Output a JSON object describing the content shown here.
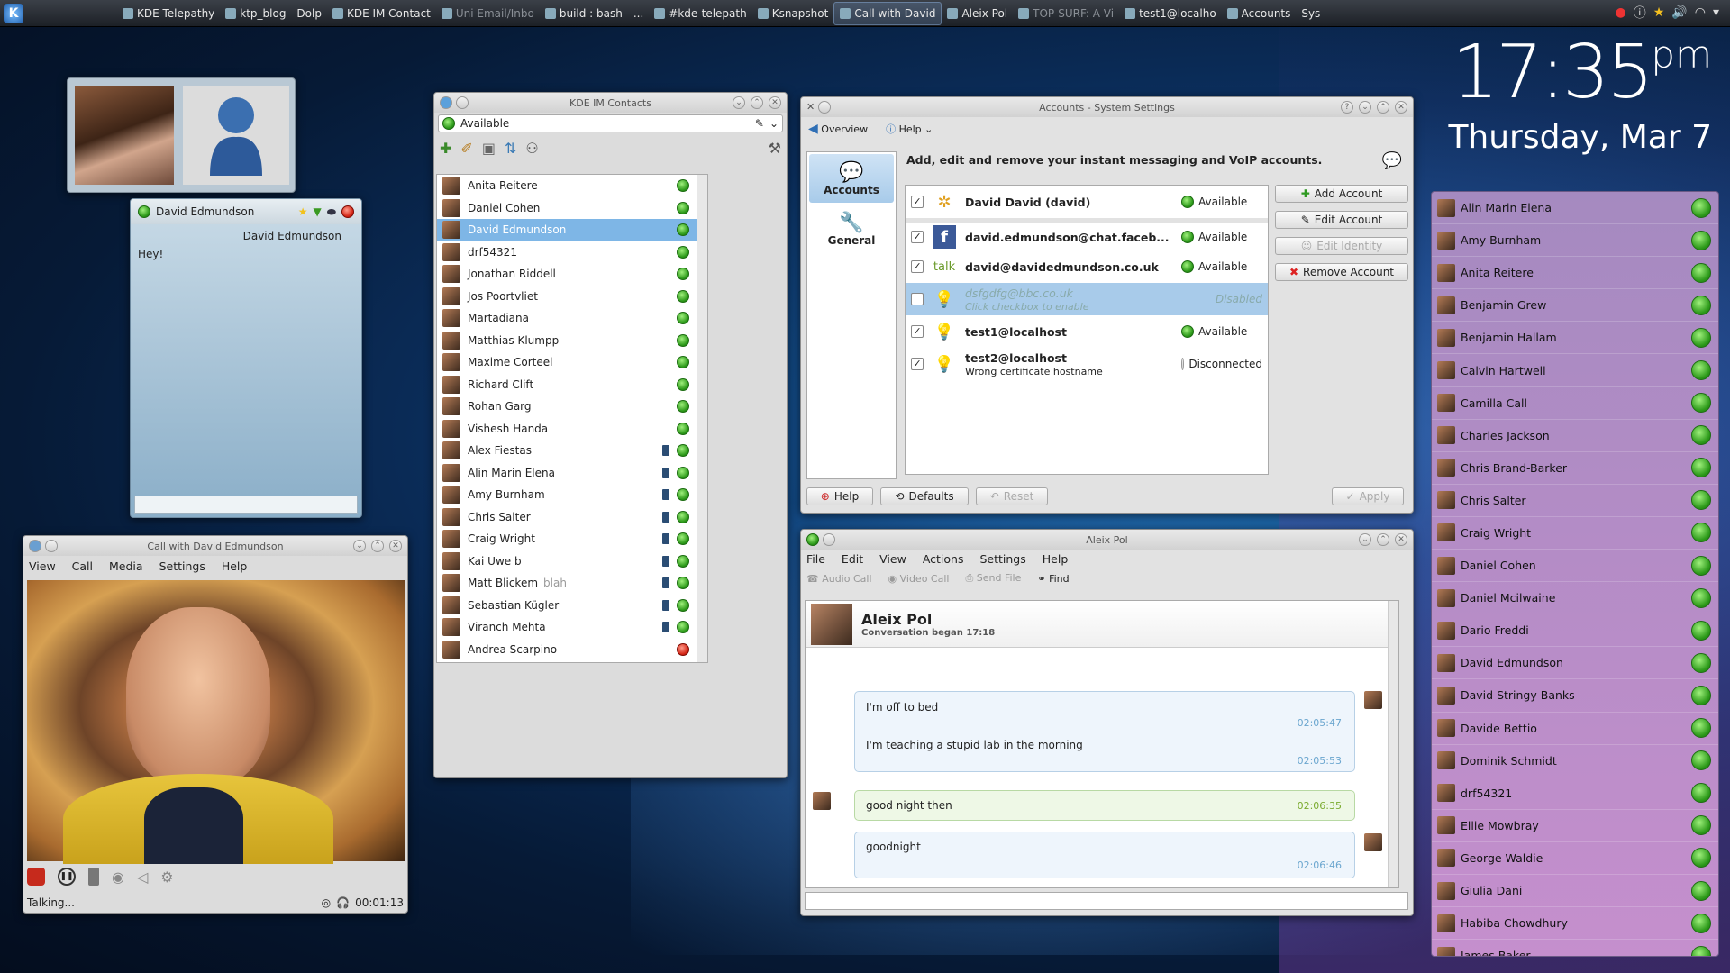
{
  "taskbar": {
    "tasks": [
      "KDE Telepathy",
      "ktp_blog - Dolp",
      "KDE IM Contact",
      "Uni Email/Inbo",
      "build : bash - ...",
      "#kde-telepath",
      "Ksnapshot",
      "Call with David",
      "Aleix Pol",
      "TOP-SURF: A Vi",
      "test1@localho",
      "Accounts - Sys"
    ]
  },
  "clock": {
    "time": "17:35",
    "ampm": "pm",
    "date": "Thursday, Mar 7"
  },
  "contact_popup": {
    "name": "David Edmundson",
    "header": "David Edmundson",
    "message": "Hey!"
  },
  "contacts_window": {
    "title": "KDE IM Contacts",
    "status": "Available",
    "contacts": [
      {
        "name": "Anita Reitere",
        "phone": false,
        "status": "available"
      },
      {
        "name": "Daniel Cohen",
        "phone": false,
        "status": "available"
      },
      {
        "name": "David Edmundson",
        "phone": false,
        "status": "available",
        "selected": true
      },
      {
        "name": "drf54321",
        "phone": false,
        "status": "available"
      },
      {
        "name": "Jonathan Riddell",
        "phone": false,
        "status": "available"
      },
      {
        "name": "Jos Poortvliet",
        "phone": false,
        "status": "available"
      },
      {
        "name": "Martadiana",
        "phone": false,
        "status": "available"
      },
      {
        "name": "Matthias Klumpp",
        "phone": false,
        "status": "available"
      },
      {
        "name": "Maxime Corteel",
        "phone": false,
        "status": "available"
      },
      {
        "name": "Richard Clift",
        "phone": false,
        "status": "available"
      },
      {
        "name": "Rohan Garg",
        "phone": false,
        "status": "available"
      },
      {
        "name": "Vishesh Handa",
        "phone": false,
        "status": "available"
      },
      {
        "name": "Alex Fiestas",
        "phone": true,
        "status": "available"
      },
      {
        "name": "Alin Marin Elena",
        "phone": true,
        "status": "available"
      },
      {
        "name": "Amy Burnham",
        "phone": true,
        "status": "available"
      },
      {
        "name": "Chris Salter",
        "phone": true,
        "status": "available"
      },
      {
        "name": "Craig Wright",
        "phone": true,
        "status": "available"
      },
      {
        "name": "Kai Uwe b",
        "phone": true,
        "status": "available"
      },
      {
        "name": "Matt Blickem",
        "note": "blah",
        "phone": true,
        "status": "available"
      },
      {
        "name": "Sebastian Kügler",
        "phone": true,
        "status": "available"
      },
      {
        "name": "Viranch Mehta",
        "phone": true,
        "status": "available"
      },
      {
        "name": "Andrea Scarpino",
        "phone": false,
        "status": "busy"
      }
    ]
  },
  "call_window": {
    "title": "Call with David Edmundson",
    "menu": [
      "View",
      "Call",
      "Media",
      "Settings",
      "Help"
    ],
    "status": "Talking...",
    "duration": "00:01:13"
  },
  "settings_window": {
    "title": "Accounts - System Settings",
    "toolbar": {
      "overview": "Overview",
      "help": "Help"
    },
    "sidebar": [
      "Accounts",
      "General"
    ],
    "heading": "Add, edit and remove your instant messaging and VoIP accounts.",
    "accounts": [
      {
        "name": "David David (david)",
        "sub": "",
        "status": "Available",
        "checked": true,
        "enabled": true
      },
      {
        "name": "david.edmundson@chat.faceb...",
        "sub": "",
        "status": "Available",
        "checked": true,
        "enabled": true
      },
      {
        "name": "david@davidedmundson.co.uk",
        "sub": "",
        "status": "Available",
        "checked": true,
        "enabled": true
      },
      {
        "name": "dsfgdfg@bbc.co.uk",
        "sub": "Click checkbox to enable",
        "status": "Disabled",
        "checked": false,
        "enabled": false
      },
      {
        "name": "test1@localhost",
        "sub": "",
        "status": "Available",
        "checked": true,
        "enabled": true
      },
      {
        "name": "test2@localhost",
        "sub": "Wrong certificate hostname",
        "status": "Disconnected",
        "checked": true,
        "enabled": true
      }
    ],
    "buttons": {
      "add": "Add Account",
      "edit": "Edit Account",
      "identity": "Edit Identity",
      "remove": "Remove Account"
    },
    "bottom": {
      "help": "Help",
      "defaults": "Defaults",
      "reset": "Reset",
      "apply": "Apply"
    }
  },
  "chat_window": {
    "title": "Aleix Pol",
    "menu": [
      "File",
      "Edit",
      "View",
      "Actions",
      "Settings",
      "Help"
    ],
    "toolbar": {
      "audio": "Audio Call",
      "video": "Video Call",
      "file": "Send File",
      "find": "Find"
    },
    "contact": "Aleix Pol",
    "began": "Conversation began 17:18",
    "messages": [
      {
        "text": "I'm off to bed",
        "time": "02:05:47"
      },
      {
        "text": "I'm teaching a stupid lab in the morning",
        "time": "02:05:53"
      },
      {
        "text": "good night then",
        "time": "02:06:35"
      },
      {
        "text": "goodnight",
        "time": "02:06:46"
      }
    ]
  },
  "right_contacts": [
    "Alin Marin Elena",
    "Amy Burnham",
    "Anita Reitere",
    "Benjamin Grew",
    "Benjamin Hallam",
    "Calvin Hartwell",
    "Camilla Call",
    "Charles Jackson",
    "Chris Brand-Barker",
    "Chris Salter",
    "Craig Wright",
    "Daniel Cohen",
    "Daniel Mcilwaine",
    "Dario Freddi",
    "David Edmundson",
    "David Stringy Banks",
    "Davide Bettio",
    "Dominik Schmidt",
    "drf54321",
    "Ellie Mowbray",
    "George Waldie",
    "Giulia Dani",
    "Habiba Chowdhury",
    "James Baker"
  ]
}
